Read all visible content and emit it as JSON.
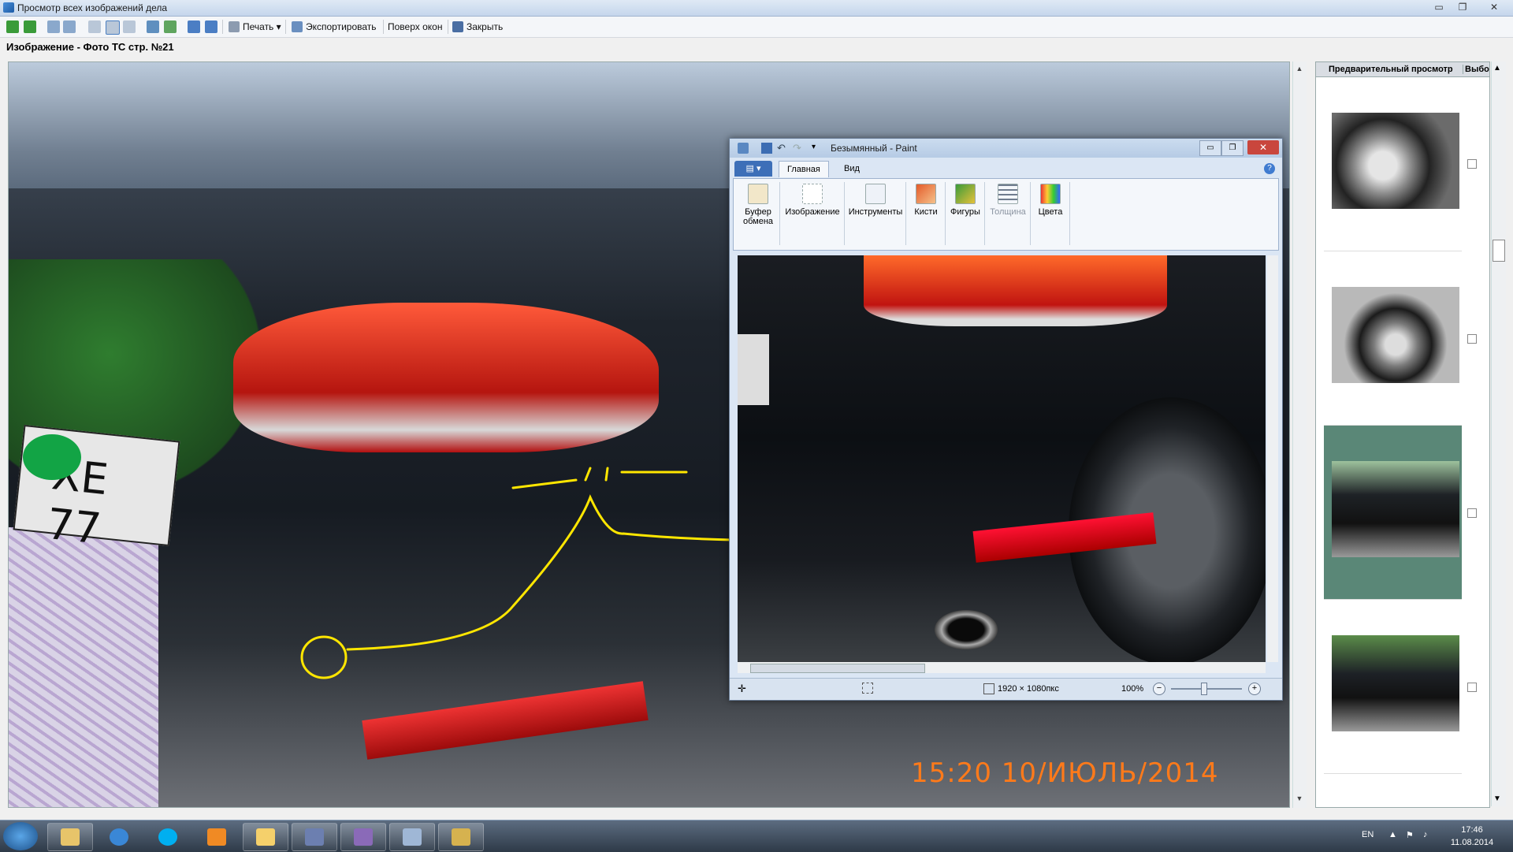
{
  "window": {
    "title": "Просмотр всех изображений дела",
    "min_glyph": "▭",
    "max_glyph": "❐",
    "close_glyph": "✕"
  },
  "toolbar": {
    "print_label": "Печать",
    "export_label": "Экспортировать",
    "ontop_label": "Поверх окон",
    "close_label": "Закрыть",
    "nav_icons": [
      "back-arrow-icon",
      "forward-arrow-icon",
      "zoom-in-icon",
      "zoom-out-icon",
      "fit-page-icon",
      "fit-width-icon",
      "actual-size-icon",
      "first-page-icon",
      "refresh-icon",
      "rotate-left-icon",
      "rotate-right-icon"
    ]
  },
  "caption": "Изображение - Фото ТС  стр. №21",
  "viewer": {
    "plate_text": "XE 77",
    "timestamp_overlay": "15:20  10/ИЮЛЬ/2014",
    "annotation_color": "#ffe600",
    "marker_color": "#12a445"
  },
  "right_panel": {
    "col_preview": "Предварительный просмотр",
    "col_select": "Выбор",
    "thumbnails": [
      {
        "name": "wheel-closeup",
        "selected": false,
        "checked": false
      },
      {
        "name": "wheel-arch",
        "selected": false,
        "checked": false
      },
      {
        "name": "rear-three-quarter",
        "selected": true,
        "checked": true
      },
      {
        "name": "rear-view-car",
        "selected": false,
        "checked": false
      }
    ],
    "selected_color": "#5a8777"
  },
  "paint": {
    "title": "Безымянный - Paint",
    "tab_home": "Главная",
    "tab_view": "Вид",
    "groups": [
      {
        "label": "Буфер обмена",
        "icon": "clipboard-icon"
      },
      {
        "label": "Изображение",
        "icon": "image-icon"
      },
      {
        "label": "Инструменты",
        "icon": "tools-icon"
      },
      {
        "label": "Кисти",
        "icon": "brush-icon"
      },
      {
        "label": "Фигуры",
        "icon": "shapes-icon"
      },
      {
        "label": "Толщина",
        "icon": "thickness-icon"
      },
      {
        "label": "Цвета",
        "icon": "colors-icon"
      }
    ],
    "status_dim": "1920 × 1080пкс",
    "status_zoom": "100%"
  },
  "taskbar": {
    "lang": "EN",
    "time": "17:46",
    "date": "11.08.2014",
    "apps": [
      "explorer-icon",
      "ie-icon",
      "skype-icon",
      "media-player-icon",
      "folder-icon",
      "scanner-icon",
      "case-viewer-icon",
      "app-icon",
      "paint-icon"
    ]
  }
}
